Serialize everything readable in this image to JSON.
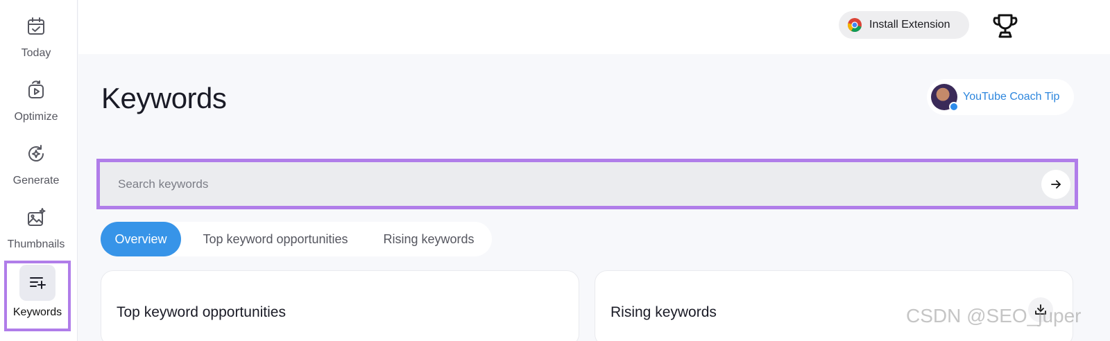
{
  "sidebar": {
    "items": [
      {
        "label": "Today",
        "icon": "calendar-check-icon"
      },
      {
        "label": "Optimize",
        "icon": "video-refresh-icon"
      },
      {
        "label": "Generate",
        "icon": "sparkle-refresh-icon"
      },
      {
        "label": "Thumbnails",
        "icon": "image-sparkle-icon"
      },
      {
        "label": "Keywords",
        "icon": "list-plus-icon",
        "active": true
      }
    ]
  },
  "topbar": {
    "install_label": "Install Extension",
    "install_icon": "chrome-icon",
    "trophy_icon": "trophy-icon"
  },
  "main": {
    "title": "Keywords",
    "coach_tip": "YouTube Coach Tip",
    "search": {
      "placeholder": "Search keywords",
      "value": ""
    },
    "tabs": [
      {
        "label": "Overview",
        "active": true
      },
      {
        "label": "Top keyword opportunities"
      },
      {
        "label": "Rising keywords"
      }
    ],
    "cards": [
      {
        "title": "Top keyword opportunities"
      },
      {
        "title": "Rising keywords"
      }
    ]
  },
  "watermark": "CSDN @SEO_juper",
  "colors": {
    "accent": "#3794e8",
    "highlight": "#b07de9",
    "link": "#2d86dd"
  }
}
